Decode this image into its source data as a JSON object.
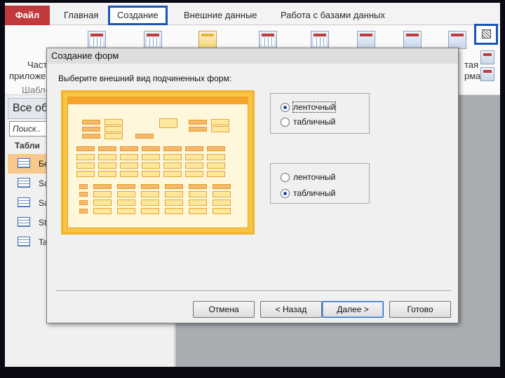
{
  "ribbon_tabs": [
    "Файл",
    "Главная",
    "Создание",
    "Внешние данные",
    "Работа с базами данных"
  ],
  "ribbon_labels": {
    "parts_line1": "Част",
    "parts_line2": "приложе",
    "templates": "Шабло",
    "right_line1": "тая",
    "right_line2": "рма"
  },
  "highlight_color": "#1a55b3",
  "nav": {
    "header": "Все об",
    "search_placeholder": "Поиск..",
    "group": "Табли",
    "items": [
      {
        "label": "Бе",
        "selected": true
      },
      {
        "label": "Sa"
      },
      {
        "label": "Sa"
      },
      {
        "label": "St"
      },
      {
        "label": "Ta"
      }
    ]
  },
  "dialog": {
    "title": "Создание форм",
    "prompt": "Выберите внешний вид подчиненных форм:",
    "group1": {
      "option_ribbon": "ленточный",
      "option_table": "табличный",
      "selected": "ленточный"
    },
    "group2": {
      "option_ribbon": "ленточный",
      "option_table": "табличный",
      "selected": "табличный"
    },
    "buttons": {
      "cancel": "Отмена",
      "back": "< Назад",
      "next": "Далее >",
      "finish": "Готово"
    }
  }
}
